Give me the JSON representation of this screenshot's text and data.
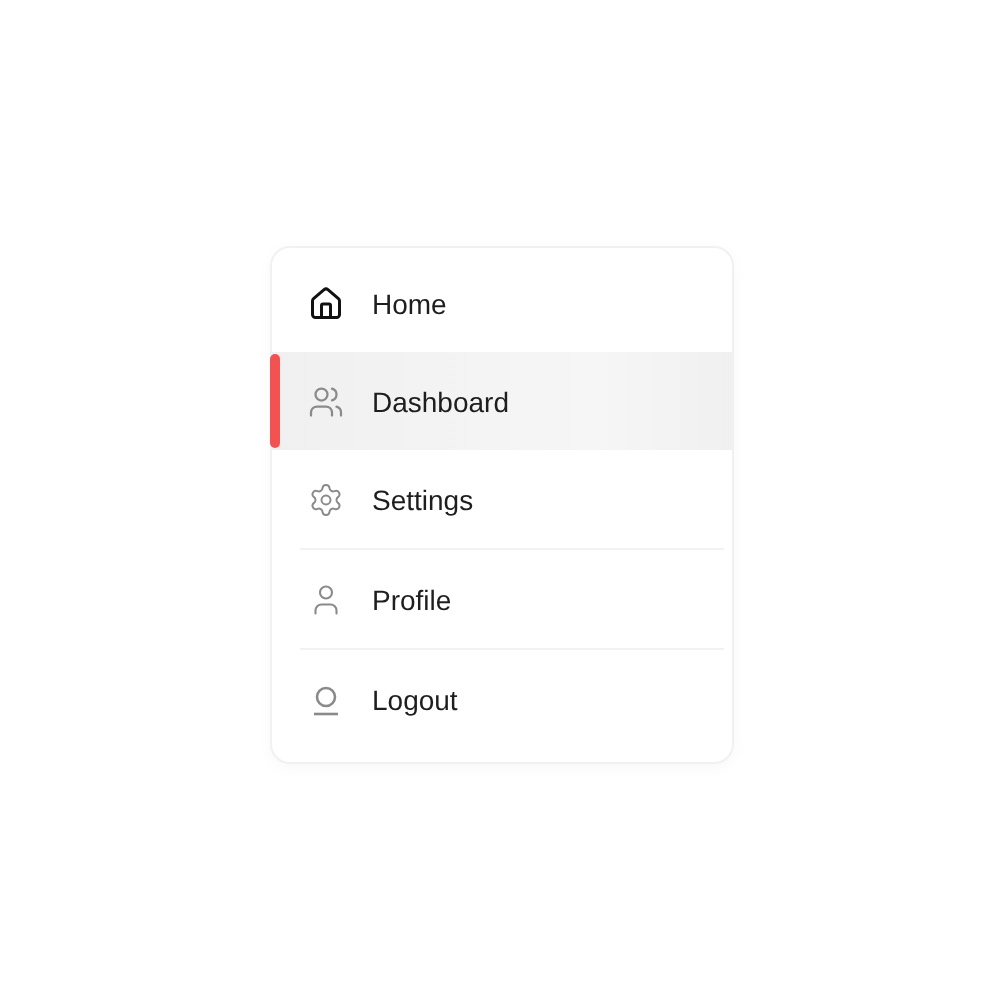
{
  "menu": {
    "items": [
      {
        "label": "Home",
        "selected": false
      },
      {
        "label": "Dashboard",
        "selected": true
      },
      {
        "label": "Settings",
        "selected": false
      },
      {
        "label": "Profile",
        "selected": false
      },
      {
        "label": "Logout",
        "selected": false
      }
    ]
  }
}
